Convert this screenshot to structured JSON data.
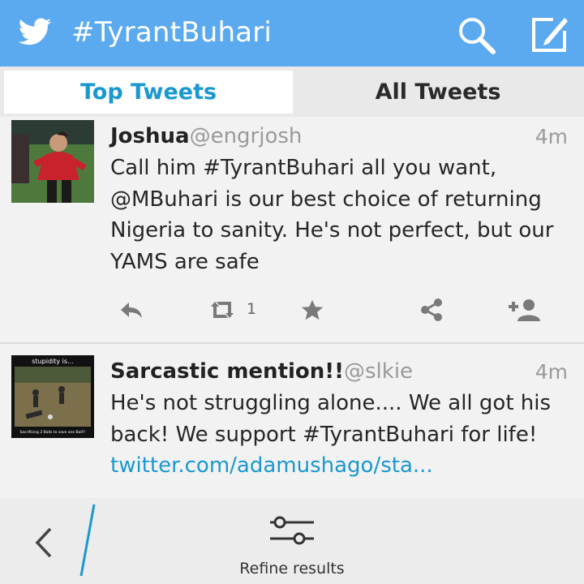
{
  "header": {
    "title": "#TyrantBuhari",
    "brand_color": "#5baaf0"
  },
  "tabs": [
    {
      "label": "Top Tweets",
      "active": true
    },
    {
      "label": "All Tweets",
      "active": false
    }
  ],
  "tweets": [
    {
      "name": "Joshua",
      "handle": "@engrjosh",
      "time": "4m",
      "lines": [
        "Call him #TyrantBuhari all you want,",
        "@MBuhari is our best choice of returning",
        "Nigeria to sanity. He's not perfect, but our",
        "YAMS are safe"
      ],
      "retweet_count": "1"
    },
    {
      "name": "Sarcastic mention!!",
      "handle": "@slkie",
      "time": "4m",
      "lines": [
        "He's not struggling alone.... We all got his",
        "back! We support #TyrantBuhari for life!"
      ],
      "link": "twitter.com/adamushago/sta...",
      "avatar_caption_top": "stupidity is...",
      "avatar_caption_bottom": "Sacrificing 2 Balls to save one Ball!!"
    }
  ],
  "footer": {
    "refine_label": "Refine results"
  },
  "icons": {
    "bird": "twitter-bird-icon",
    "search": "search-icon",
    "compose": "compose-icon",
    "reply": "reply-icon",
    "retweet": "retweet-icon",
    "favorite": "star-icon",
    "share": "share-icon",
    "follow": "follow-icon",
    "back": "back-chevron-icon",
    "refine": "refine-sliders-icon"
  }
}
